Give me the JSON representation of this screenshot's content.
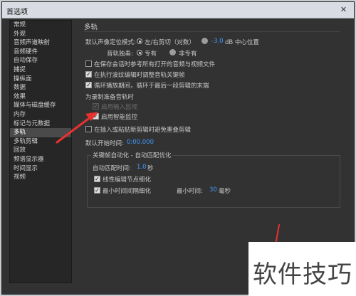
{
  "window": {
    "title": "首选项",
    "close_glyph": "✕"
  },
  "sidebar": {
    "items": [
      {
        "label": "常规"
      },
      {
        "label": "外观"
      },
      {
        "label": "音频声道映射"
      },
      {
        "label": "音频硬件"
      },
      {
        "label": "自动保存"
      },
      {
        "label": "捕捉"
      },
      {
        "label": "操纵面"
      },
      {
        "label": "数据"
      },
      {
        "label": "效果"
      },
      {
        "label": "媒体与磁盘缓存"
      },
      {
        "label": "内存"
      },
      {
        "label": "标记与元数据"
      },
      {
        "label": "多轨",
        "selected": true
      },
      {
        "label": "多轨剪辑"
      },
      {
        "label": "回放"
      },
      {
        "label": "频谱显示器"
      },
      {
        "label": "时间显示"
      },
      {
        "label": "视频"
      }
    ]
  },
  "multitrack": {
    "section_title": "多轨",
    "pan_mode_label": "默认声像定位模式:",
    "pan_option_lr": "左/右剪切（对数）",
    "pan_db_value": "-3.0",
    "pan_db_suffix": "dB 中心位置",
    "stereo_label": "音轨独奏:",
    "stereo_option_exclusive": "专有",
    "stereo_option_nonexclusive": "非专有",
    "cb_save_all_when_saving": "在保存会话时参考所有打开的音频与视频文件",
    "cb_adjust_keyframes": "在执行波纹编辑时调整音轨关键帧",
    "cb_loop_playback": "循环播放期间，循环于最后一段剪辑的末端",
    "record_heading": "为录制准备音轨时",
    "cb_enable_input_monitoring": "启用输入监视",
    "cb_enable_smart_monitoring": "启用智能监控",
    "cb_overwrite_clips": "在插入或粘贴新剪辑时避免重叠剪辑",
    "default_start_label": "默认开始时间:",
    "default_start_value": "0:00.000",
    "automation_group_title": "关键帧自动化 - 自动匹配优化",
    "auto_match_label": "自动匹配时间:",
    "auto_match_value": "1.0",
    "auto_match_unit": "秒",
    "cb_linear_edit": "线性编辑节点细化",
    "cb_min_time": "最小时间间隔细化",
    "min_time_label": "最小时间:",
    "min_time_value": "30",
    "min_time_unit": "毫秒"
  },
  "watermark": {
    "text": "软件技巧"
  },
  "colors": {
    "accent_value": "#3f9bff",
    "annotation_arrow": "#e8322f"
  },
  "icons": {
    "close": "close-icon",
    "checkmark": "checkmark-icon",
    "arrow": "annotation-arrow-icon"
  }
}
